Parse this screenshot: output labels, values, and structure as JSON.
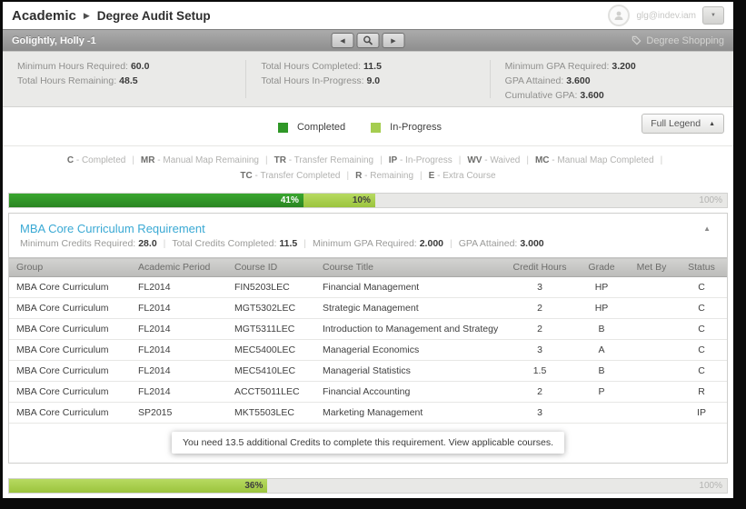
{
  "header": {
    "breadcrumb": {
      "root": "Academic",
      "current": "Degree Audit Setup"
    },
    "user_email": "glg@indev.iam"
  },
  "icons": {
    "breadcrumb_separator": "▶",
    "prev_arrow": "◀",
    "next_arrow": "▶",
    "user_menu_caret": "▼",
    "full_legend_caret": "▲",
    "collapse_caret": "▲"
  },
  "student_bar": {
    "name": "Golightly, Holly -1",
    "degree_shopping_label": "Degree Shopping"
  },
  "summary": {
    "left": [
      {
        "label": "Minimum Hours Required:",
        "value": "60.0"
      },
      {
        "label": "Total Hours Remaining:",
        "value": "48.5"
      }
    ],
    "mid": [
      {
        "label": "Total Hours Completed:",
        "value": "11.5"
      },
      {
        "label": "Total Hours In-Progress:",
        "value": "9.0"
      }
    ],
    "right": [
      {
        "label": "Minimum GPA Required:",
        "value": "3.200"
      },
      {
        "label": "GPA Attained:",
        "value": "3.600"
      },
      {
        "label": "Cumulative GPA:",
        "value": "3.600"
      }
    ]
  },
  "legend": {
    "completed_label": "Completed",
    "inprogress_label": "In-Progress",
    "full_legend_label": "Full Legend",
    "colors": {
      "completed": "#2f9727",
      "in_progress": "#a5cd50"
    },
    "line1": [
      {
        "code": "C",
        "desc": "- Completed"
      },
      {
        "code": "MR",
        "desc": "- Manual Map Remaining"
      },
      {
        "code": "TR",
        "desc": "- Transfer Remaining"
      },
      {
        "code": "IP",
        "desc": "- In-Progress"
      },
      {
        "code": "WV",
        "desc": "- Waived"
      },
      {
        "code": "MC",
        "desc": "- Manual Map Completed"
      }
    ],
    "line2": [
      {
        "code": "TC",
        "desc": "- Transfer Completed"
      },
      {
        "code": "R",
        "desc": "- Remaining"
      },
      {
        "code": "E",
        "desc": "- Extra Course"
      }
    ]
  },
  "progress_top": {
    "completed_pct": "41%",
    "inprogress_pct": "10%",
    "max_label": "100%"
  },
  "progress_bottom": {
    "inprogress_pct": "36%",
    "max_label": "100%"
  },
  "requirement": {
    "title": "MBA Core Curriculum Requirement",
    "title_color": "#3aa9d4",
    "stats": [
      {
        "label": "Minimum Credits Required:",
        "value": "28.0"
      },
      {
        "label": "Total Credits Completed:",
        "value": "11.5"
      },
      {
        "label": "Minimum GPA Required:",
        "value": "2.000"
      },
      {
        "label": "GPA Attained:",
        "value": "3.000"
      }
    ],
    "table": {
      "headers": [
        "Group",
        "Academic Period",
        "Course ID",
        "Course Title",
        "Credit Hours",
        "Grade",
        "Met By",
        "Status"
      ],
      "rows": [
        {
          "group": "MBA Core Curriculum",
          "period": "FL2014",
          "course_id": "FIN5203LEC",
          "title": "Financial Management",
          "credits": "3",
          "grade": "HP",
          "met_by": "",
          "status": "C"
        },
        {
          "group": "MBA Core Curriculum",
          "period": "FL2014",
          "course_id": "MGT5302LEC",
          "title": "Strategic Management",
          "credits": "2",
          "grade": "HP",
          "met_by": "",
          "status": "C"
        },
        {
          "group": "MBA Core Curriculum",
          "period": "FL2014",
          "course_id": "MGT5311LEC",
          "title": "Introduction to Management and Strategy",
          "credits": "2",
          "grade": "B",
          "met_by": "",
          "status": "C"
        },
        {
          "group": "MBA Core Curriculum",
          "period": "FL2014",
          "course_id": "MEC5400LEC",
          "title": "Managerial Economics",
          "credits": "3",
          "grade": "A",
          "met_by": "",
          "status": "C"
        },
        {
          "group": "MBA Core Curriculum",
          "period": "FL2014",
          "course_id": "MEC5410LEC",
          "title": "Managerial Statistics",
          "credits": "1.5",
          "grade": "B",
          "met_by": "",
          "status": "C"
        },
        {
          "group": "MBA Core Curriculum",
          "period": "FL2014",
          "course_id": "ACCT5011LEC",
          "title": "Financial Accounting",
          "credits": "2",
          "grade": "P",
          "met_by": "",
          "status": "R"
        },
        {
          "group": "MBA Core Curriculum",
          "period": "SP2015",
          "course_id": "MKT5503LEC",
          "title": "Marketing Management",
          "credits": "3",
          "grade": "",
          "met_by": "",
          "status": "IP"
        }
      ]
    },
    "message": "You need 13.5 additional Credits to complete this requirement.",
    "message_link": "View applicable courses."
  }
}
